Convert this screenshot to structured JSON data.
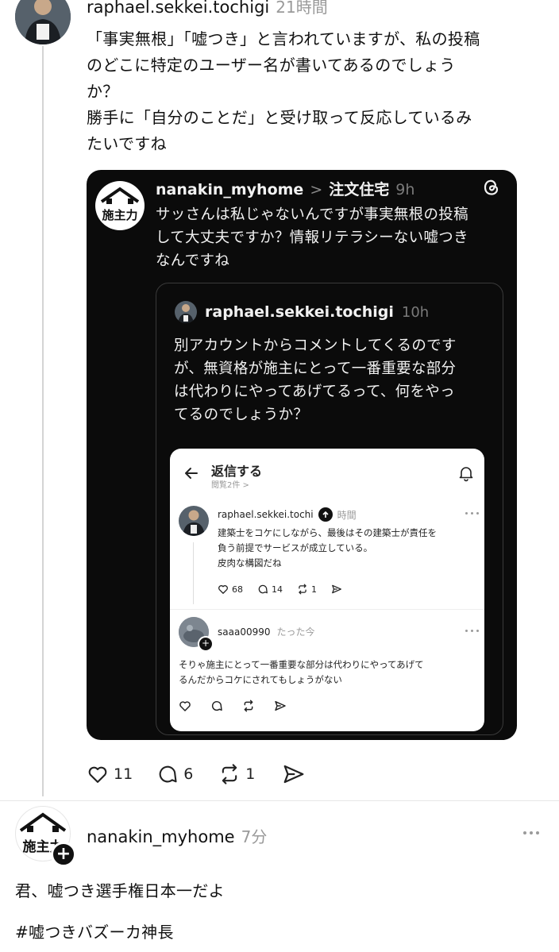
{
  "post1": {
    "username": "raphael.sekkei.tochigi",
    "time": "21時間",
    "text": "「事実無根」「嘘つき」と言われていますが、私の投稿\nのどこに特定のユーザー名が書いてあるのでしょう\nか？\n勝手に「自分のことだ」と受け取って反応しているみ\nたいですね",
    "likes": "11",
    "replies": "6",
    "reposts": "1"
  },
  "embedded": {
    "avatar_text": "施主力",
    "username": "nanakin_myhome",
    "topic_sep": ">",
    "topic": "注文住宅",
    "time": "9h",
    "text": "サッさんは私じゃないんですが事実無根の投稿\nして大丈夫ですか？情報リテラシーない嘘つき\nなんですね",
    "quote": {
      "username": "raphael.sekkei.tochigi",
      "time": "10h",
      "text": "別アカウントからコメントしてくるのです\nが、無資格が施主にとって一番重要な部分\nは代わりにやってあげてるって、何をやっ\nてるのでしょうか？"
    },
    "screenshot": {
      "header_title": "返信する",
      "header_sub": "閲覧2件 >",
      "reply1": {
        "username": "raphael.sekkei.tochi",
        "time": "時間",
        "text": "建築士をコケにしながら、最後はその建築士が責任を\n負う前提でサービスが成立している。\n皮肉な構図だね",
        "likes": "68",
        "replies": "14",
        "reposts": "1"
      },
      "reply2": {
        "username": "saaa00990",
        "time": "たった今",
        "text": "そりゃ施主にとって一番重要な部分は代わりにやってあげて\nるんだからコケにされてもしょうがない"
      }
    }
  },
  "post2": {
    "avatar_text": "施主力",
    "username": "nanakin_myhome",
    "time": "7分",
    "line1": "君、嘘つき選手権日本一だよ",
    "line2": "#嘘つきバズーカ神長"
  }
}
